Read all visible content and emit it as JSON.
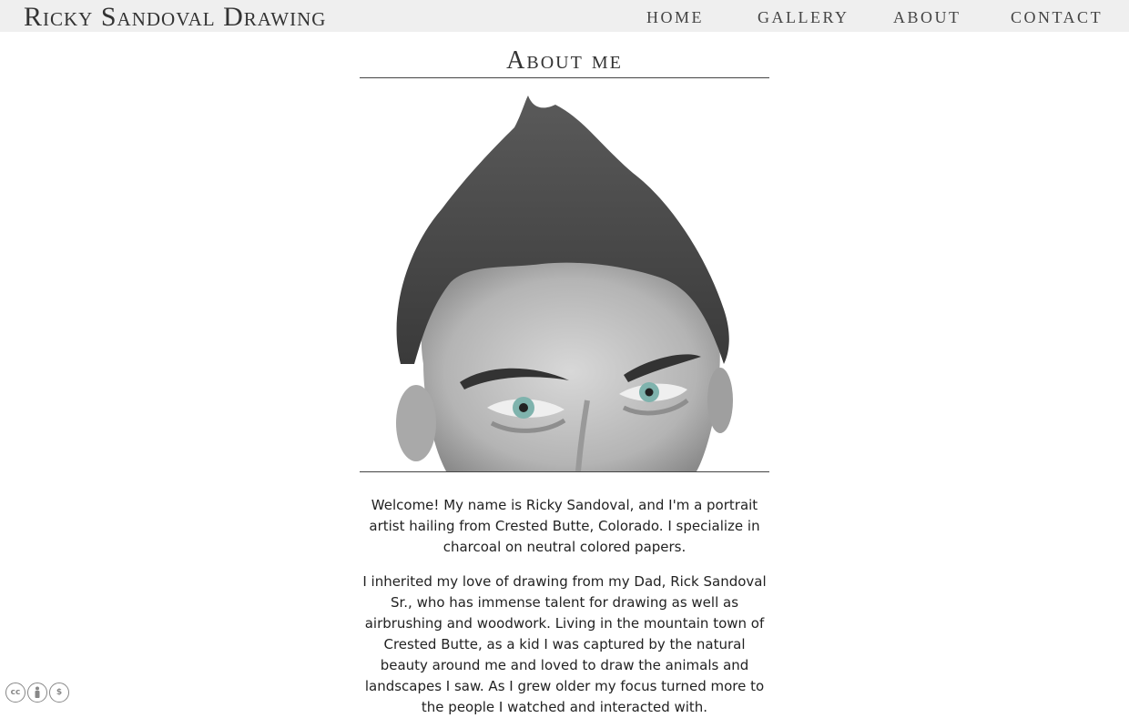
{
  "header": {
    "brand": "Ricky Sandoval Drawing",
    "nav": [
      "HOME",
      "GALLERY",
      "ABOUT",
      "CONTACT"
    ]
  },
  "main": {
    "title": "About me",
    "paragraphs": [
      "Welcome! My name is Ricky Sandoval, and I'm a portrait artist hailing from Crested Butte, Colorado. I specialize in charcoal on neutral colored papers.",
      "I inherited my love of drawing from my Dad, Rick Sandoval Sr., who has immense talent for drawing as well as airbrushing and woodwork. Living in the mountain town of Crested Butte, as a kid I was captured by the natural beauty around me and loved to draw the animals and landscapes I saw. As I grew older my focus turned more to the people I watched and interacted with."
    ]
  },
  "footer": {
    "license_icons": [
      "cc-icon",
      "by-icon",
      "nc-icon"
    ]
  },
  "colors": {
    "header_bg": "#efefef",
    "eye_accent": "#7fb3ad"
  }
}
